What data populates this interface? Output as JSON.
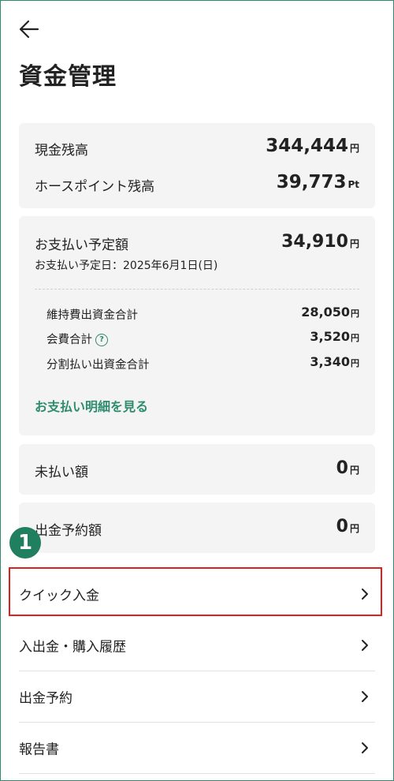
{
  "header": {
    "title": "資金管理"
  },
  "balances": {
    "cash_label": "現金残高",
    "cash_value": "344,444",
    "cash_unit": "円",
    "points_label": "ホースポイント残高",
    "points_value": "39,773",
    "points_unit": "Pt"
  },
  "payment": {
    "label": "お支払い予定額",
    "value": "34,910",
    "unit": "円",
    "date_text": "お支払い予定日：2025年6月1日(日)",
    "items": [
      {
        "label": "維持費出資金合計",
        "value": "28,050",
        "unit": "円"
      },
      {
        "label": "会費合計",
        "value": "3,520",
        "unit": "円"
      },
      {
        "label": "分割払い出資金合計",
        "value": "3,340",
        "unit": "円"
      }
    ],
    "help_icon": "?",
    "detail_link": "お支払い明細を見る"
  },
  "unpaid": {
    "label": "未払い額",
    "value": "0",
    "unit": "円"
  },
  "withdraw_reserved": {
    "label": "出金予約額",
    "value": "0",
    "unit": "円"
  },
  "menu": [
    {
      "label": "クイック入金"
    },
    {
      "label": "入出金・購入履歴"
    },
    {
      "label": "出金予約"
    },
    {
      "label": "報告書"
    }
  ],
  "annotation": {
    "step_number": "1",
    "highlight_color": "#e01f1f",
    "badge_color": "#1f7f5f"
  },
  "colors": {
    "accent": "#2e8b6e",
    "card_bg": "#f4f4f4"
  }
}
